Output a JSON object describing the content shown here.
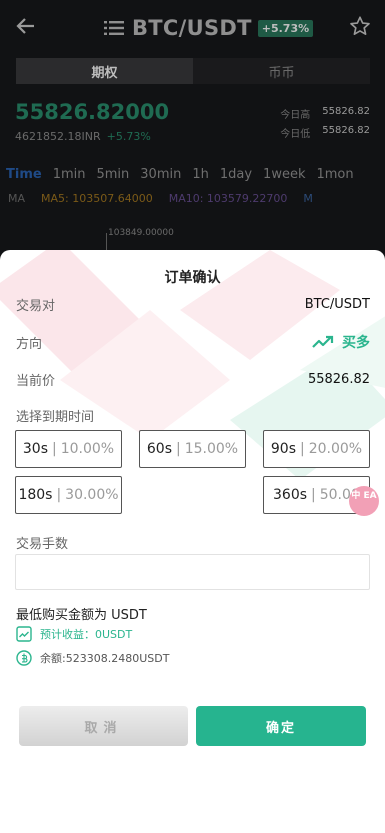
{
  "header": {
    "pair": "BTC/USDT",
    "change_badge": "+5.73%",
    "icons": {
      "back": "back-arrow-icon",
      "list": "list-icon",
      "favorite": "star-icon"
    }
  },
  "tabs": {
    "options": "期权",
    "coins": "币币"
  },
  "ticker": {
    "price": "55826.82000",
    "inr": "4621852.18INR",
    "change": "+5.73%",
    "high_label": "今日高",
    "high_value": "55826.82",
    "low_label": "今日低",
    "low_value": "55826.82"
  },
  "timeframes": [
    "Time",
    "1min",
    "5min",
    "30min",
    "1h",
    "1day",
    "1week",
    "1mon"
  ],
  "ma": {
    "ma": "MA",
    "ma5": "MA5: 103507.64000",
    "ma10": "MA10: 103579.22700",
    "m": "M"
  },
  "kline_label": "103849.00000",
  "modal": {
    "title": "订单确认",
    "pair_label": "交易对",
    "pair_value": "BTC/USDT",
    "direction_label": "方向",
    "direction_value": "买多",
    "price_label": "当前价",
    "price_value": "55826.82",
    "expiry_label": "选择到期时间",
    "expiry_options": [
      {
        "time": "30s",
        "rate": "10.00%"
      },
      {
        "time": "60s",
        "rate": "15.00%"
      },
      {
        "time": "90s",
        "rate": "20.00%"
      },
      {
        "time": "180s",
        "rate": "30.00%"
      },
      {
        "time": "360s",
        "rate": "50.00%"
      }
    ],
    "fee_label": "交易手数",
    "amount_value": "",
    "min_amount": "最低购买金额为 USDT",
    "estimated": "预计收益：0USDT",
    "balance": "余额:523308.2480USDT",
    "language_badge": "中 EA",
    "cancel": "取消",
    "confirm": "确定"
  },
  "colors": {
    "accent": "#2bb58e",
    "badge": "#f2a0b6"
  }
}
